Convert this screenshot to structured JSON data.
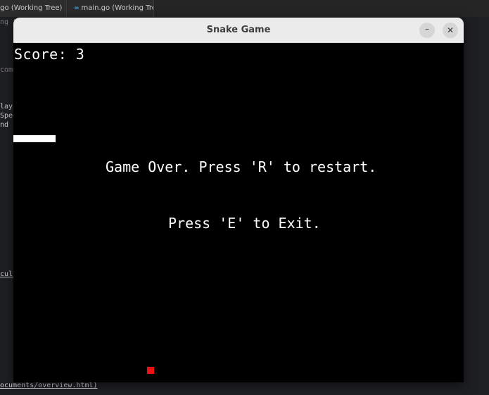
{
  "editor": {
    "tabs": [
      {
        "label": ".go (Working Tree)"
      },
      {
        "label": "main.go (Working Tree)",
        "icon": "go-file-icon"
      }
    ],
    "line_fragments": [
      "ng th",
      "comm",
      "layi",
      "Spee",
      "nd c",
      "cult"
    ],
    "status_path": "ocuments/overview.html)"
  },
  "window": {
    "title": "Snake Game",
    "minimize_symbol": "–",
    "close_symbol": "✕"
  },
  "game": {
    "score_text": "Score: 3",
    "score": 3,
    "game_over_text": "Game Over. Press 'R' to restart.",
    "exit_text": "Press 'E' to Exit.",
    "snake_color": "#ffffff",
    "food_color": "#ee1111",
    "background_color": "#000000"
  }
}
